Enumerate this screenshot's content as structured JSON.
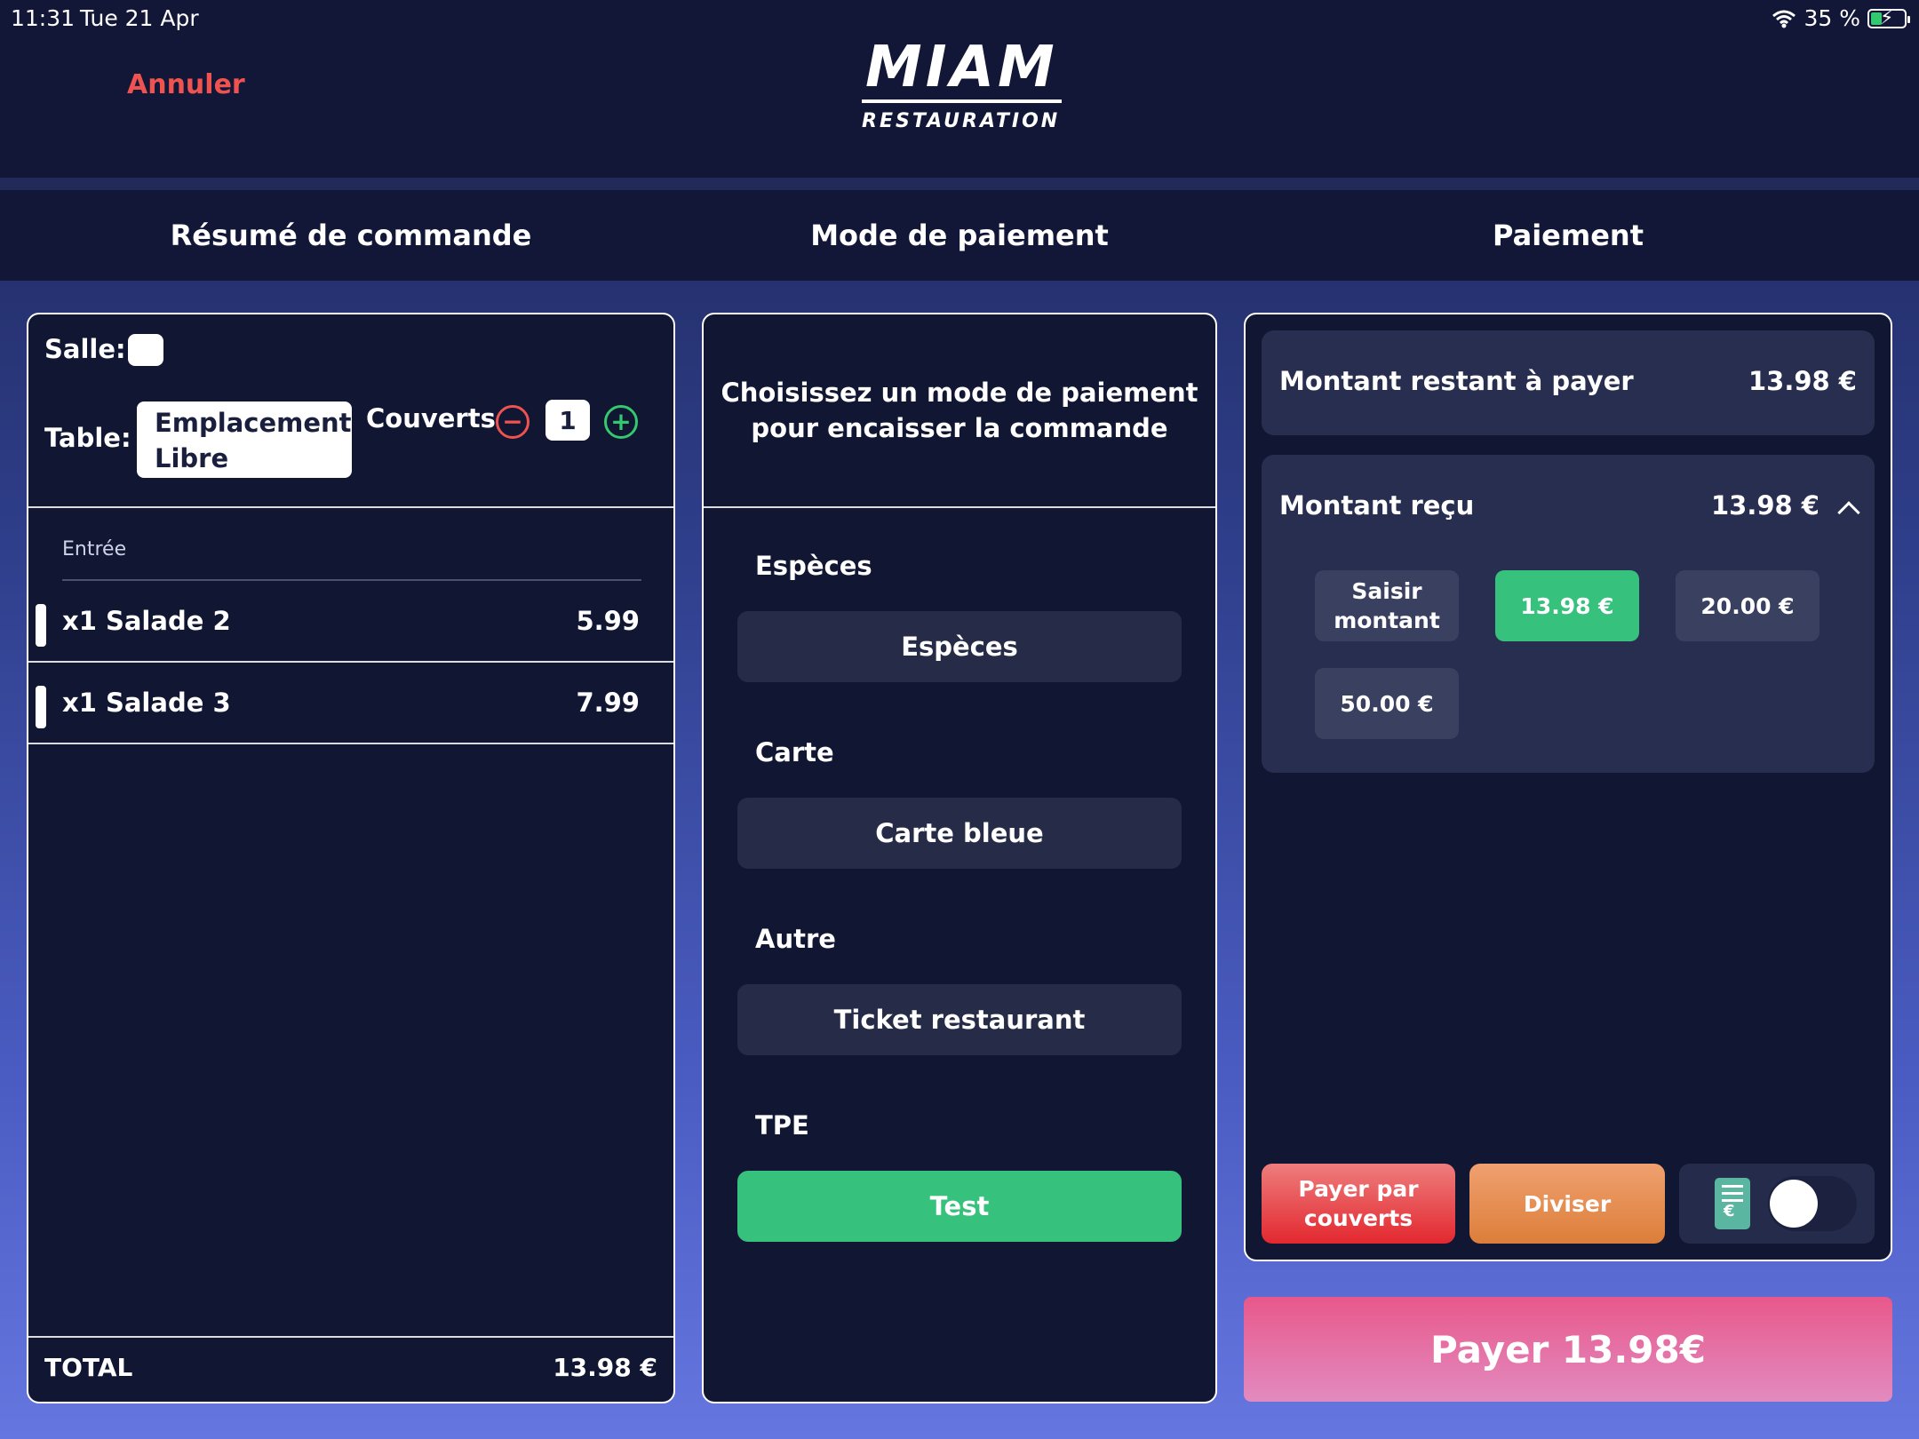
{
  "status_bar": {
    "time": "11:31",
    "date": "Tue 21 Apr",
    "battery": "35 %",
    "battery_level": 0.35
  },
  "header": {
    "cancel_label": "Annuler",
    "logo_main": "MIAM",
    "logo_sub": "RESTAURATION"
  },
  "tabs": [
    {
      "label": "Résumé de commande"
    },
    {
      "label": "Mode de paiement"
    },
    {
      "label": "Paiement"
    }
  ],
  "order": {
    "salle_label": "Salle:",
    "table_label": "Table:",
    "table_value": "Emplacement Libre",
    "couverts_label": "Couverts",
    "couverts_value": "1",
    "category": "Entrée",
    "items": [
      {
        "name": "x1 Salade 2",
        "price": "5.99"
      },
      {
        "name": "x1 Salade 3",
        "price": "7.99"
      }
    ],
    "total_label": "TOTAL",
    "total_value": "13.98 €"
  },
  "payment_mode": {
    "prompt": "Choisissez un mode de paiement pour encaisser la commande",
    "sections": [
      {
        "title": "Espèces",
        "button": "Espèces"
      },
      {
        "title": "Carte",
        "button": "Carte bleue"
      },
      {
        "title": "Autre",
        "button": "Ticket restaurant"
      },
      {
        "title": "TPE",
        "button": "Test"
      }
    ]
  },
  "payment": {
    "remaining_label": "Montant restant à payer",
    "remaining_value": "13.98 €",
    "received_label": "Montant reçu",
    "received_value": "13.98 €",
    "amount_options": [
      "Saisir montant",
      "13.98 €",
      "20.00 €",
      "50.00 €"
    ],
    "selected_amount": "13.98 €",
    "pay_by_couverts": "Payer par couverts",
    "split": "Diviser",
    "receipt_currency": "€",
    "pay_button": "Payer 13.98€"
  },
  "colors": {
    "accent_red": "#ef5350",
    "accent_green": "#36c17d",
    "panel_bg": "#111633"
  }
}
